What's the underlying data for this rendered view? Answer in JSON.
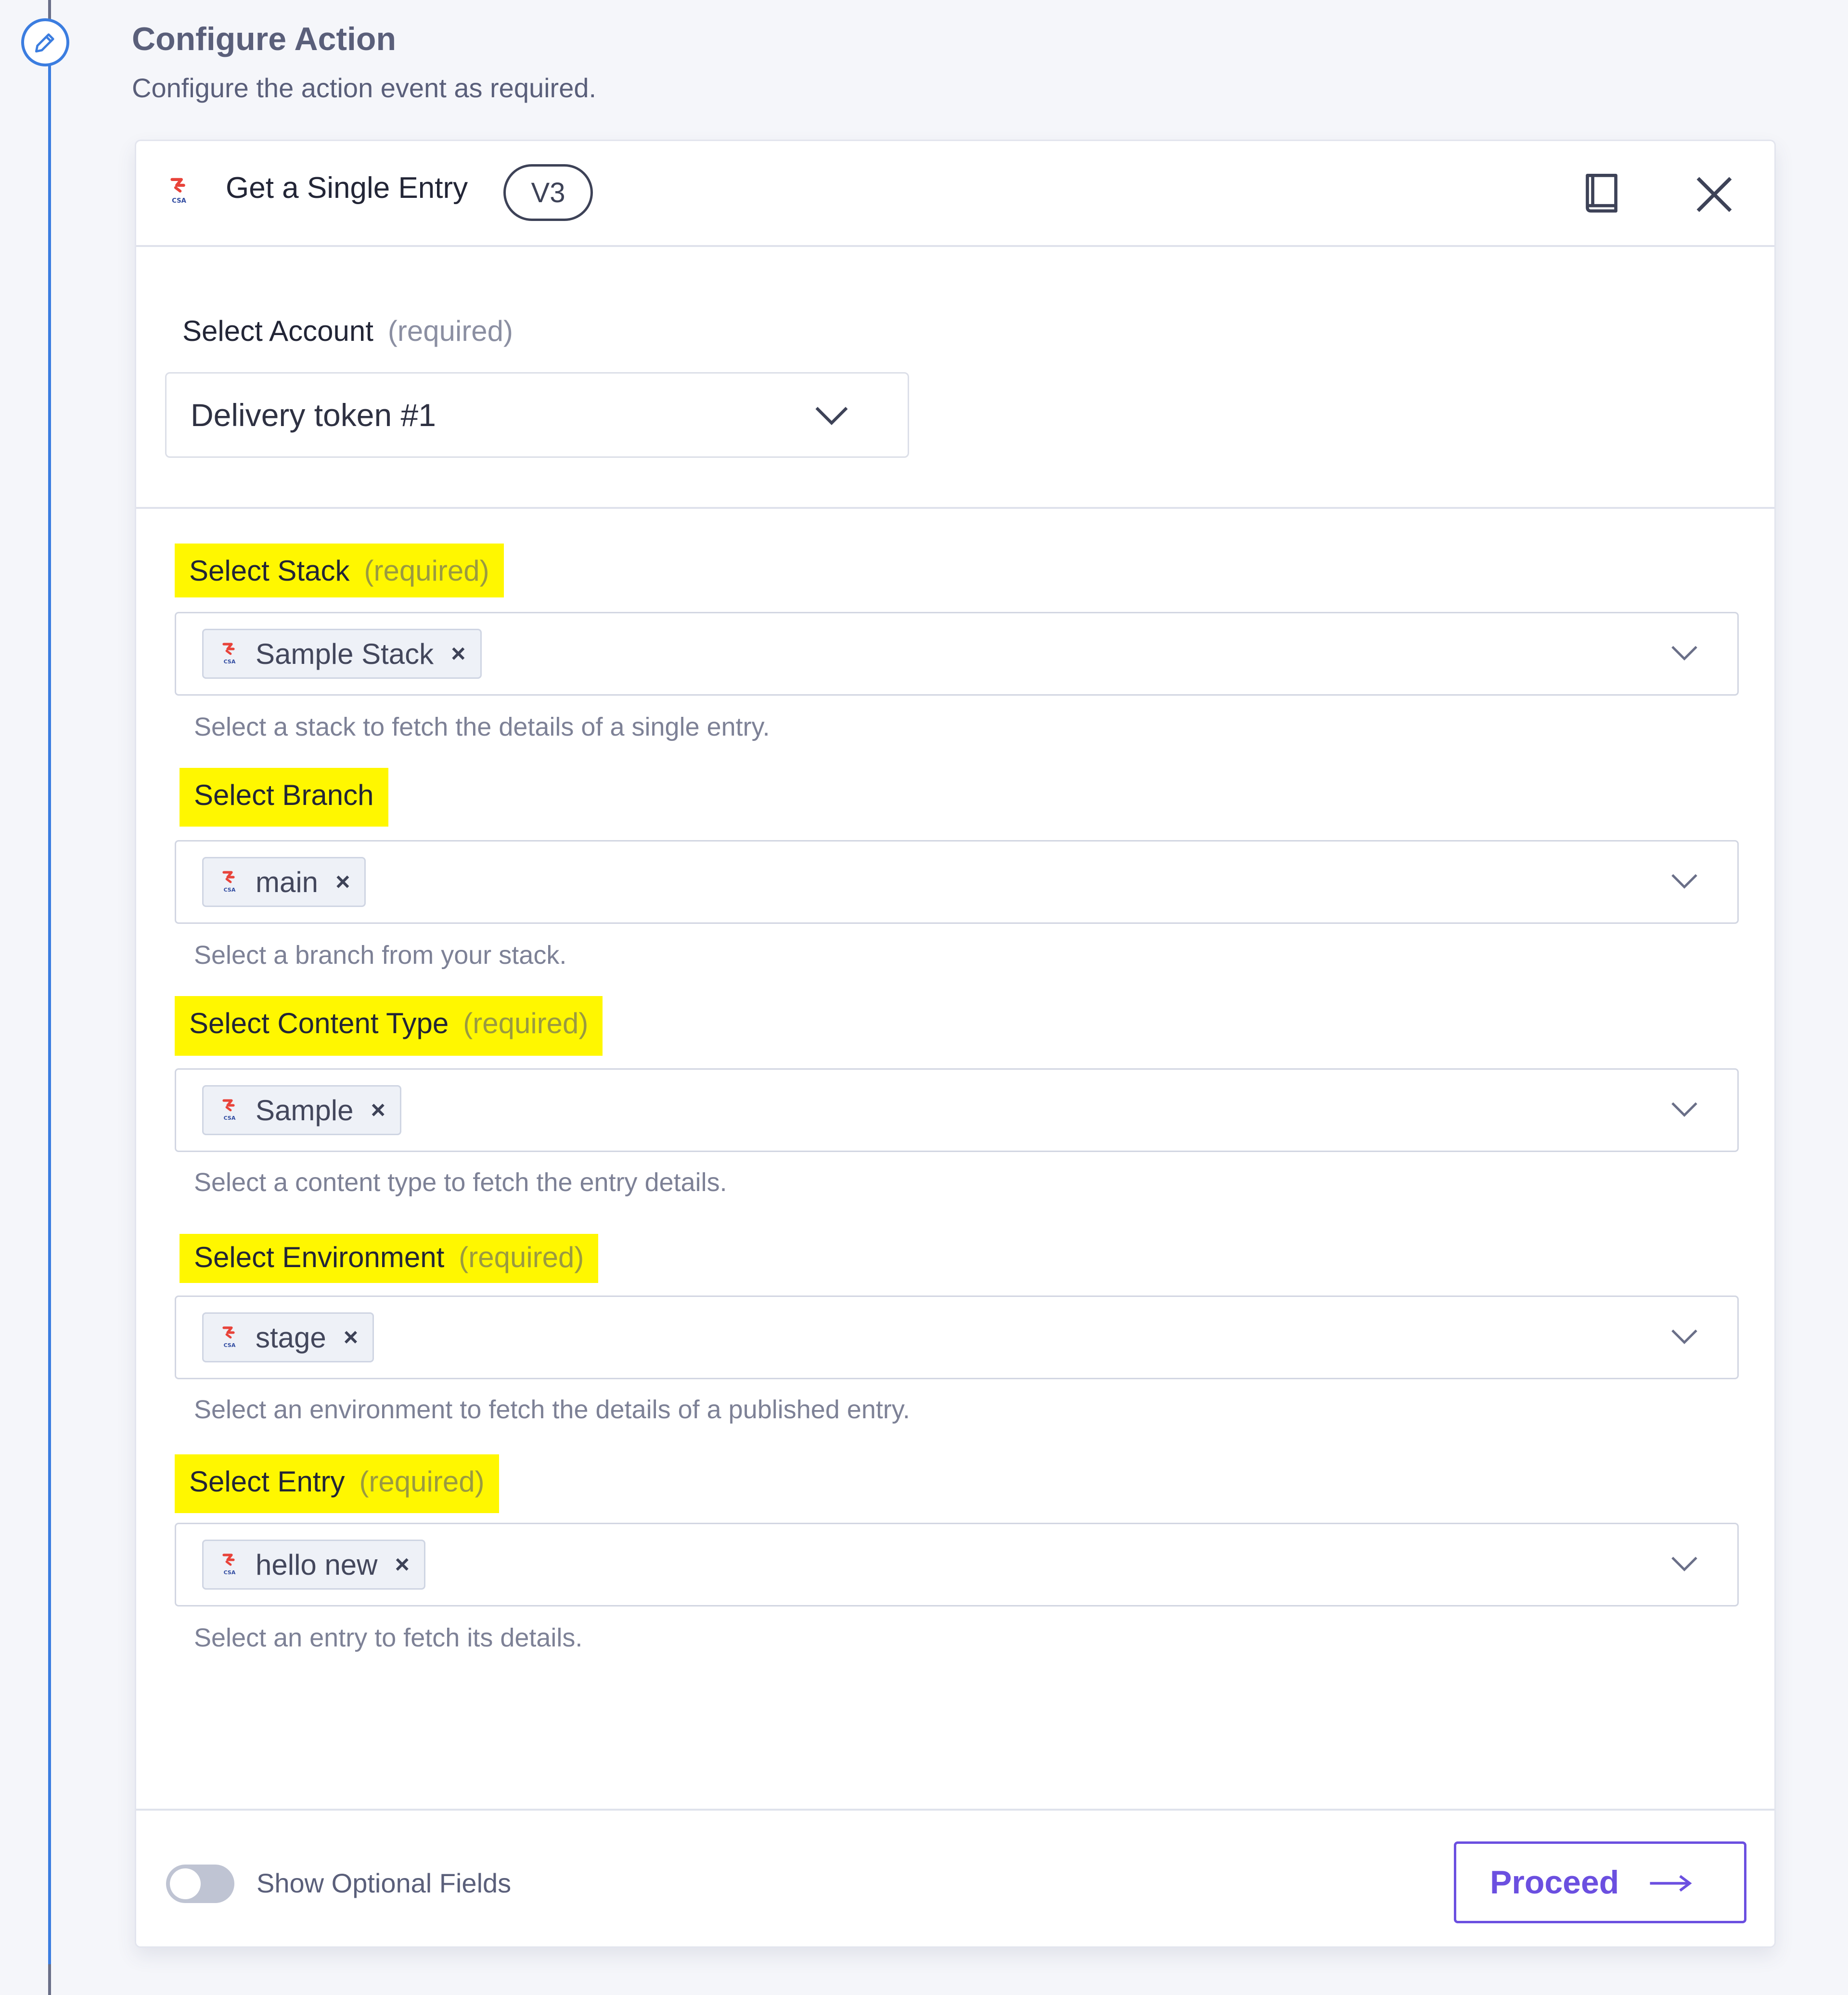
{
  "step": {
    "title": "Configure Action",
    "subtitle": "Configure the action event as required.",
    "icon": "pencil-icon"
  },
  "card": {
    "header": {
      "title": "Get a Single Entry",
      "version": "V3",
      "logo": "contentstack-logo",
      "docs_icon": "book-icon",
      "close_icon": "close-icon"
    },
    "account": {
      "label": "Select Account",
      "required": "(required)",
      "value": "Delivery token #1"
    },
    "fields": [
      {
        "label": "Select Stack",
        "required": "(required)",
        "chip": "Sample Stack",
        "helper": "Select a stack to fetch the details of a single entry."
      },
      {
        "label": "Select Branch",
        "required": "",
        "chip": "main",
        "helper": "Select a branch from your stack."
      },
      {
        "label": "Select Content Type",
        "required": "(required)",
        "chip": "Sample",
        "helper": "Select a content type to fetch the entry details."
      },
      {
        "label": "Select Environment",
        "required": "(required)",
        "chip": "stage",
        "helper": "Select an environment to fetch the details of a published entry."
      },
      {
        "label": "Select Entry",
        "required": "(required)",
        "chip": "hello new",
        "helper": "Select an entry to fetch its details."
      }
    ],
    "footer": {
      "toggle_label": "Show Optional Fields",
      "proceed_label": "Proceed"
    }
  },
  "colors": {
    "highlight": "#fff700",
    "accent": "#6b4fe0",
    "timeline": "#3b7de0"
  }
}
